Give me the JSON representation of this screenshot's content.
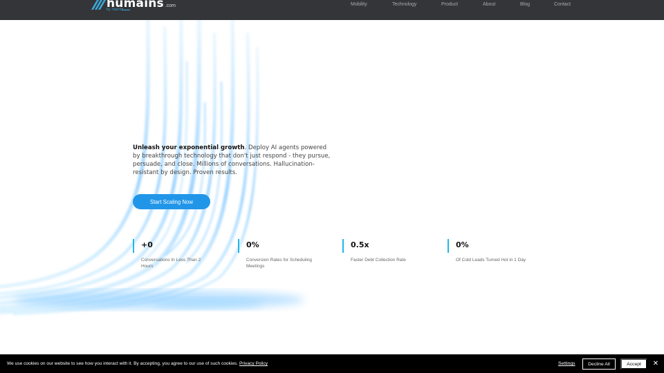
{
  "header": {
    "logo": {
      "word": "humains",
      "domain": ".com",
      "sub": "by inprim"
    },
    "nav": [
      {
        "label": "Mobility"
      },
      {
        "label": "Technology"
      },
      {
        "label": "Product"
      },
      {
        "label": "About"
      },
      {
        "label": "Blog"
      },
      {
        "label": "Contact"
      }
    ]
  },
  "hero": {
    "headline_bold": "Unleash your exponential growth",
    "body": ". Deploy AI agents powered by breakthrough technology that don't just respond - they pursue, persuade, and close. Millions of conversations. Hallucination-resistant by design. Proven results.",
    "cta_label": "Start Scaling Now"
  },
  "stats": [
    {
      "value": "+0",
      "label": "Conversations In Less Than 2 Hours"
    },
    {
      "value": "0%",
      "label": "Conversion Rates for Scheduling Meetings"
    },
    {
      "value": "0.5x",
      "label": "Faster Debt Collection Rate"
    },
    {
      "value": "0%",
      "label": "Of Cold Leads Turned Hot in 1 Day"
    }
  ],
  "cookie_banner": {
    "text": "We use cookies on our website to see how you interact with it. By accepting, you agree to our use of such cookies.",
    "policy_link": "Privacy Policy",
    "settings_label": "Settings",
    "decline_label": "Decline All",
    "accept_label": "Accept",
    "close_icon": "close-icon"
  },
  "colors": {
    "header_bg": "#343538",
    "accent_blue": "#2196e8",
    "stat_bar": "#1fb7ea",
    "cookie_bg": "#000000"
  }
}
